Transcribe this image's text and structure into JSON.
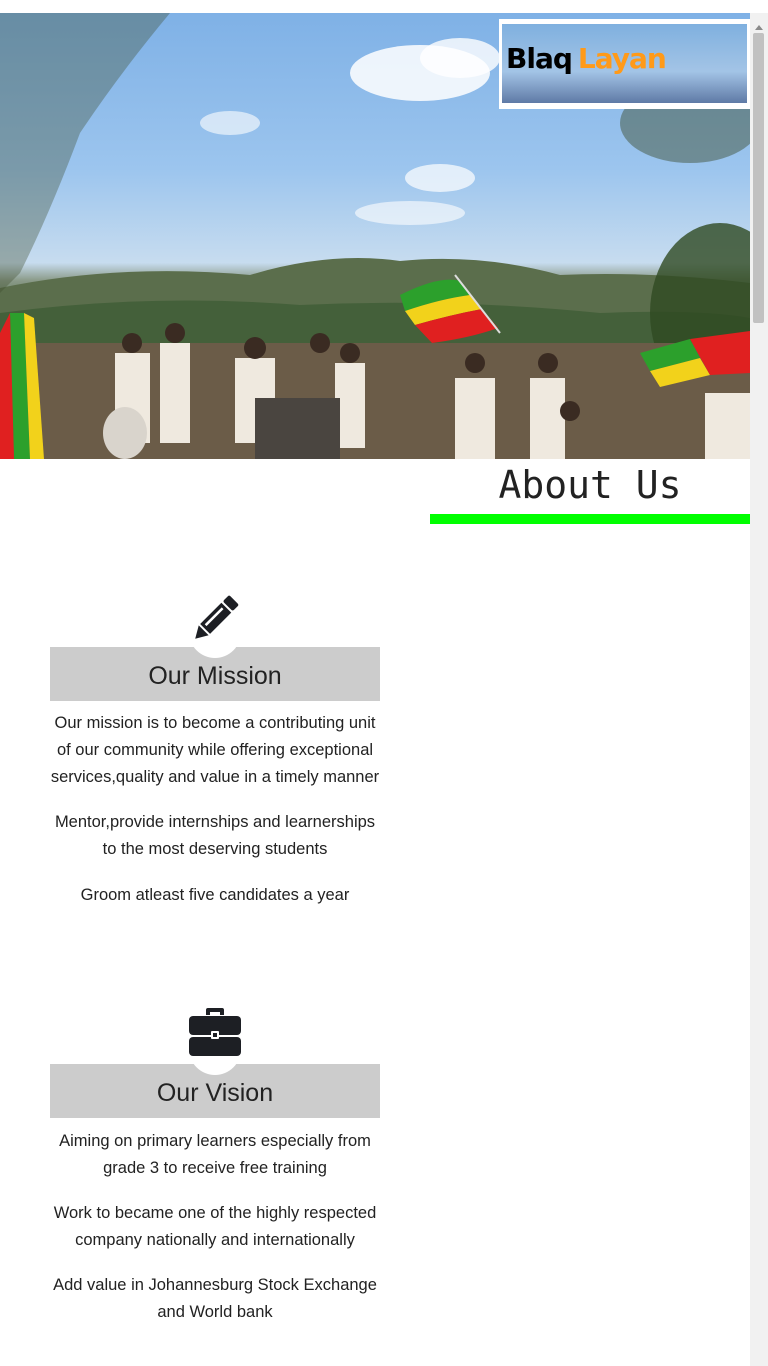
{
  "logo": {
    "part1": "Blaq",
    "part2": "Layan"
  },
  "about": {
    "title": "About Us"
  },
  "mission": {
    "icon": "pencil-icon",
    "title": "Our Mission",
    "points": [
      "Our mission is to become a contributing unit of our community while offering exceptional services,quality and value in a timely manner",
      "Mentor,provide internships and learnerships to the most deserving students",
      "Groom atleast five candidates a year"
    ]
  },
  "vision": {
    "icon": "briefcase-icon",
    "title": "Our Vision",
    "points": [
      "Aiming on primary learners especially from grade 3 to receive free training",
      "Work to became one of the highly respected company nationally and internationally",
      "Add value in Johannesburg Stock Exchange and World bank"
    ]
  },
  "colors": {
    "accent_underline": "#00ff00",
    "logo_accent": "#ff9a19",
    "card_header_bg": "#cccccc"
  }
}
